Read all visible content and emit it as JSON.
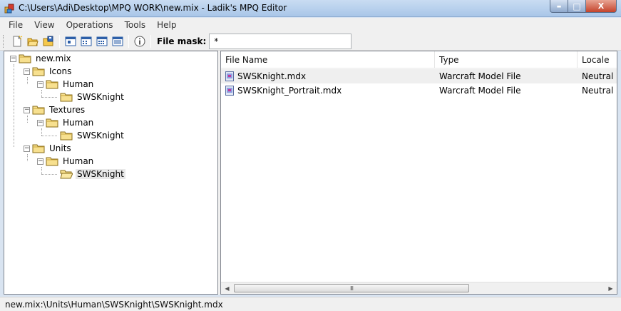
{
  "window": {
    "title": "C:\\Users\\Adi\\Desktop\\MPQ WORK\\new.mix - Ladik's MPQ Editor",
    "minimize_glyph": "▬",
    "maximize_glyph": "□",
    "close_glyph": "X"
  },
  "menu": [
    "File",
    "View",
    "Operations",
    "Tools",
    "Help"
  ],
  "toolbar": {
    "buttons": [
      "new-archive-icon",
      "open-archive-icon",
      "save-archive-icon",
      "view-large-icon",
      "view-small-icon",
      "view-list-icon",
      "view-details-icon",
      "about-icon"
    ],
    "file_mask_label": "File mask:",
    "file_mask_value": "*"
  },
  "tree": {
    "root": "new.mix",
    "icons": "Icons",
    "icons_human": "Human",
    "icons_human_knight": "SWSKnight",
    "textures": "Textures",
    "textures_human": "Human",
    "textures_human_knight": "SWSKnight",
    "units": "Units",
    "units_human": "Human",
    "units_human_knight": "SWSKnight",
    "expander_glyph": "−"
  },
  "list": {
    "columns": [
      "File Name",
      "Type",
      "Locale"
    ],
    "rows": [
      {
        "name": "SWSKnight.mdx",
        "type": "Warcraft Model File",
        "locale": "Neutral"
      },
      {
        "name": "SWSKnight_Portrait.mdx",
        "type": "Warcraft Model File",
        "locale": "Neutral"
      }
    ]
  },
  "scrollbar": {
    "left_arrow": "◀",
    "right_arrow": "▶",
    "grip": "III"
  },
  "status": {
    "text": "new.mix:\\Units\\Human\\SWSKnight\\SWSKnight.mdx"
  }
}
